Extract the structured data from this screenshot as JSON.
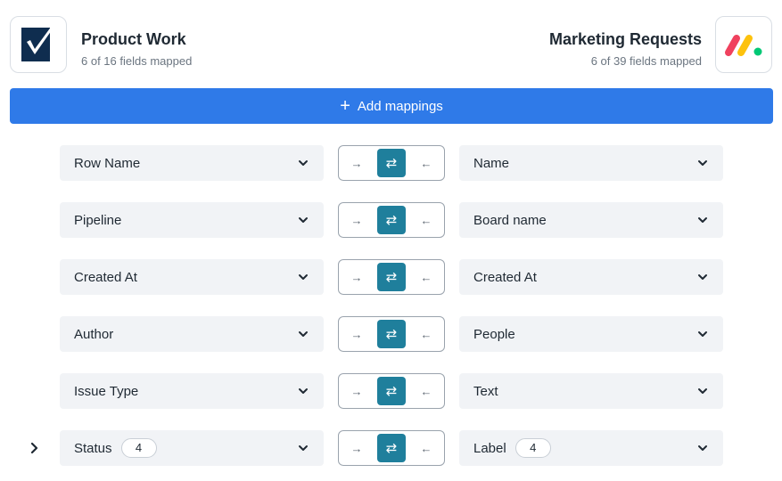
{
  "left_app": {
    "name": "Product Work",
    "subtitle": "6 of 16 fields mapped",
    "logo_icon": "smartsheet-check-logo",
    "logo_color": "#0f2d4f"
  },
  "right_app": {
    "name": "Marketing Requests",
    "subtitle": "6 of 39 fields mapped",
    "logo_icon": "monday-logo",
    "logo_colors": [
      "#f0415e",
      "#fdc20d",
      "#00c875"
    ]
  },
  "add_button": {
    "label": "Add mappings",
    "icon": "plus-icon",
    "color": "#2f7ae8"
  },
  "direction_controls": {
    "right_arrow": "→",
    "both_arrows": "⇄",
    "left_arrow": "←",
    "active": "both",
    "active_color": "#1f7f9c"
  },
  "mappings": [
    {
      "left": "Row Name",
      "right": "Name"
    },
    {
      "left": "Pipeline",
      "right": "Board name"
    },
    {
      "left": "Created At",
      "right": "Created At"
    },
    {
      "left": "Author",
      "right": "People"
    },
    {
      "left": "Issue Type",
      "right": "Text"
    },
    {
      "left": "Status",
      "left_badge": "4",
      "right": "Label",
      "right_badge": "4",
      "expandable": true
    }
  ]
}
